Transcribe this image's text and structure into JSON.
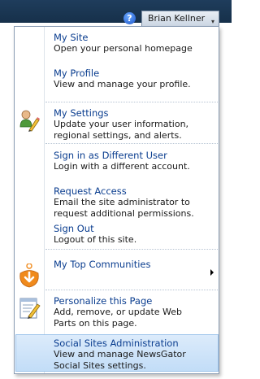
{
  "header": {
    "help_glyph": "?",
    "user_name": "Brian Kellner",
    "dropdown_glyph": "▾"
  },
  "menu": {
    "items": [
      {
        "title": "My Site",
        "desc": [
          "Open your personal homepage"
        ]
      },
      {
        "title": "My Profile",
        "desc": [
          "View and manage your profile."
        ]
      },
      {
        "title": "My Settings",
        "desc": [
          "Update your user information,",
          "regional settings, and alerts."
        ]
      },
      {
        "title": "Sign in as Different User",
        "desc": [
          "Login with a different account."
        ]
      },
      {
        "title": "Request Access",
        "desc": [
          "Email the site administrator to",
          "request additional permissions."
        ]
      },
      {
        "title": "Sign Out",
        "desc": [
          "Logout of this site."
        ]
      },
      {
        "title": "My Top Communities",
        "desc": []
      },
      {
        "title": "Personalize this Page",
        "desc": [
          "Add, remove, or update Web",
          "Parts on this page."
        ]
      },
      {
        "title": "Social Sites Administration",
        "desc": [
          "View and manage NewsGator",
          "Social Sites settings."
        ]
      }
    ]
  },
  "icons": {
    "help": "help-icon",
    "settings": "user-pencil-icon",
    "communities": "communities-icon",
    "personalize": "edit-page-icon"
  }
}
